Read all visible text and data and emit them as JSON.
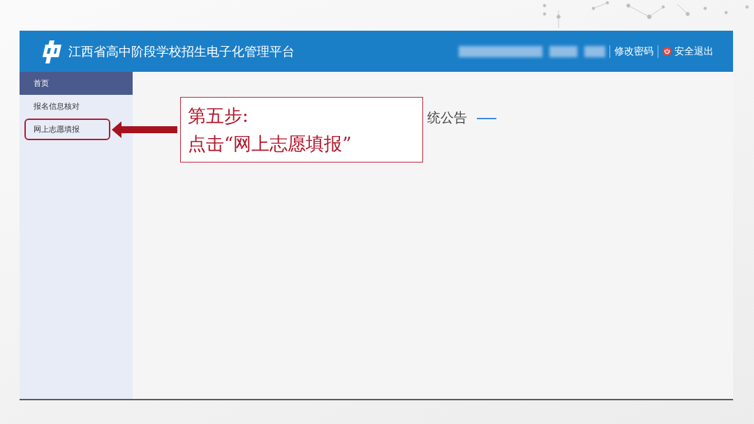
{
  "header": {
    "title": "江西省高中阶段学校招生电子化管理平台",
    "links": [
      {
        "kind": "change-password",
        "label": "修改密码"
      },
      {
        "kind": "logout",
        "label": "安全退出"
      }
    ]
  },
  "sidebar": {
    "items": [
      {
        "label": "首页",
        "selected": true,
        "highlighted": false
      },
      {
        "label": "报名信息核对",
        "selected": false,
        "highlighted": false
      },
      {
        "label": "网上志愿填报",
        "selected": false,
        "highlighted": true
      }
    ]
  },
  "main": {
    "heading": "统公告"
  },
  "callout": {
    "lines": [
      "第五步:",
      "点击“网上志愿填报”"
    ]
  }
}
